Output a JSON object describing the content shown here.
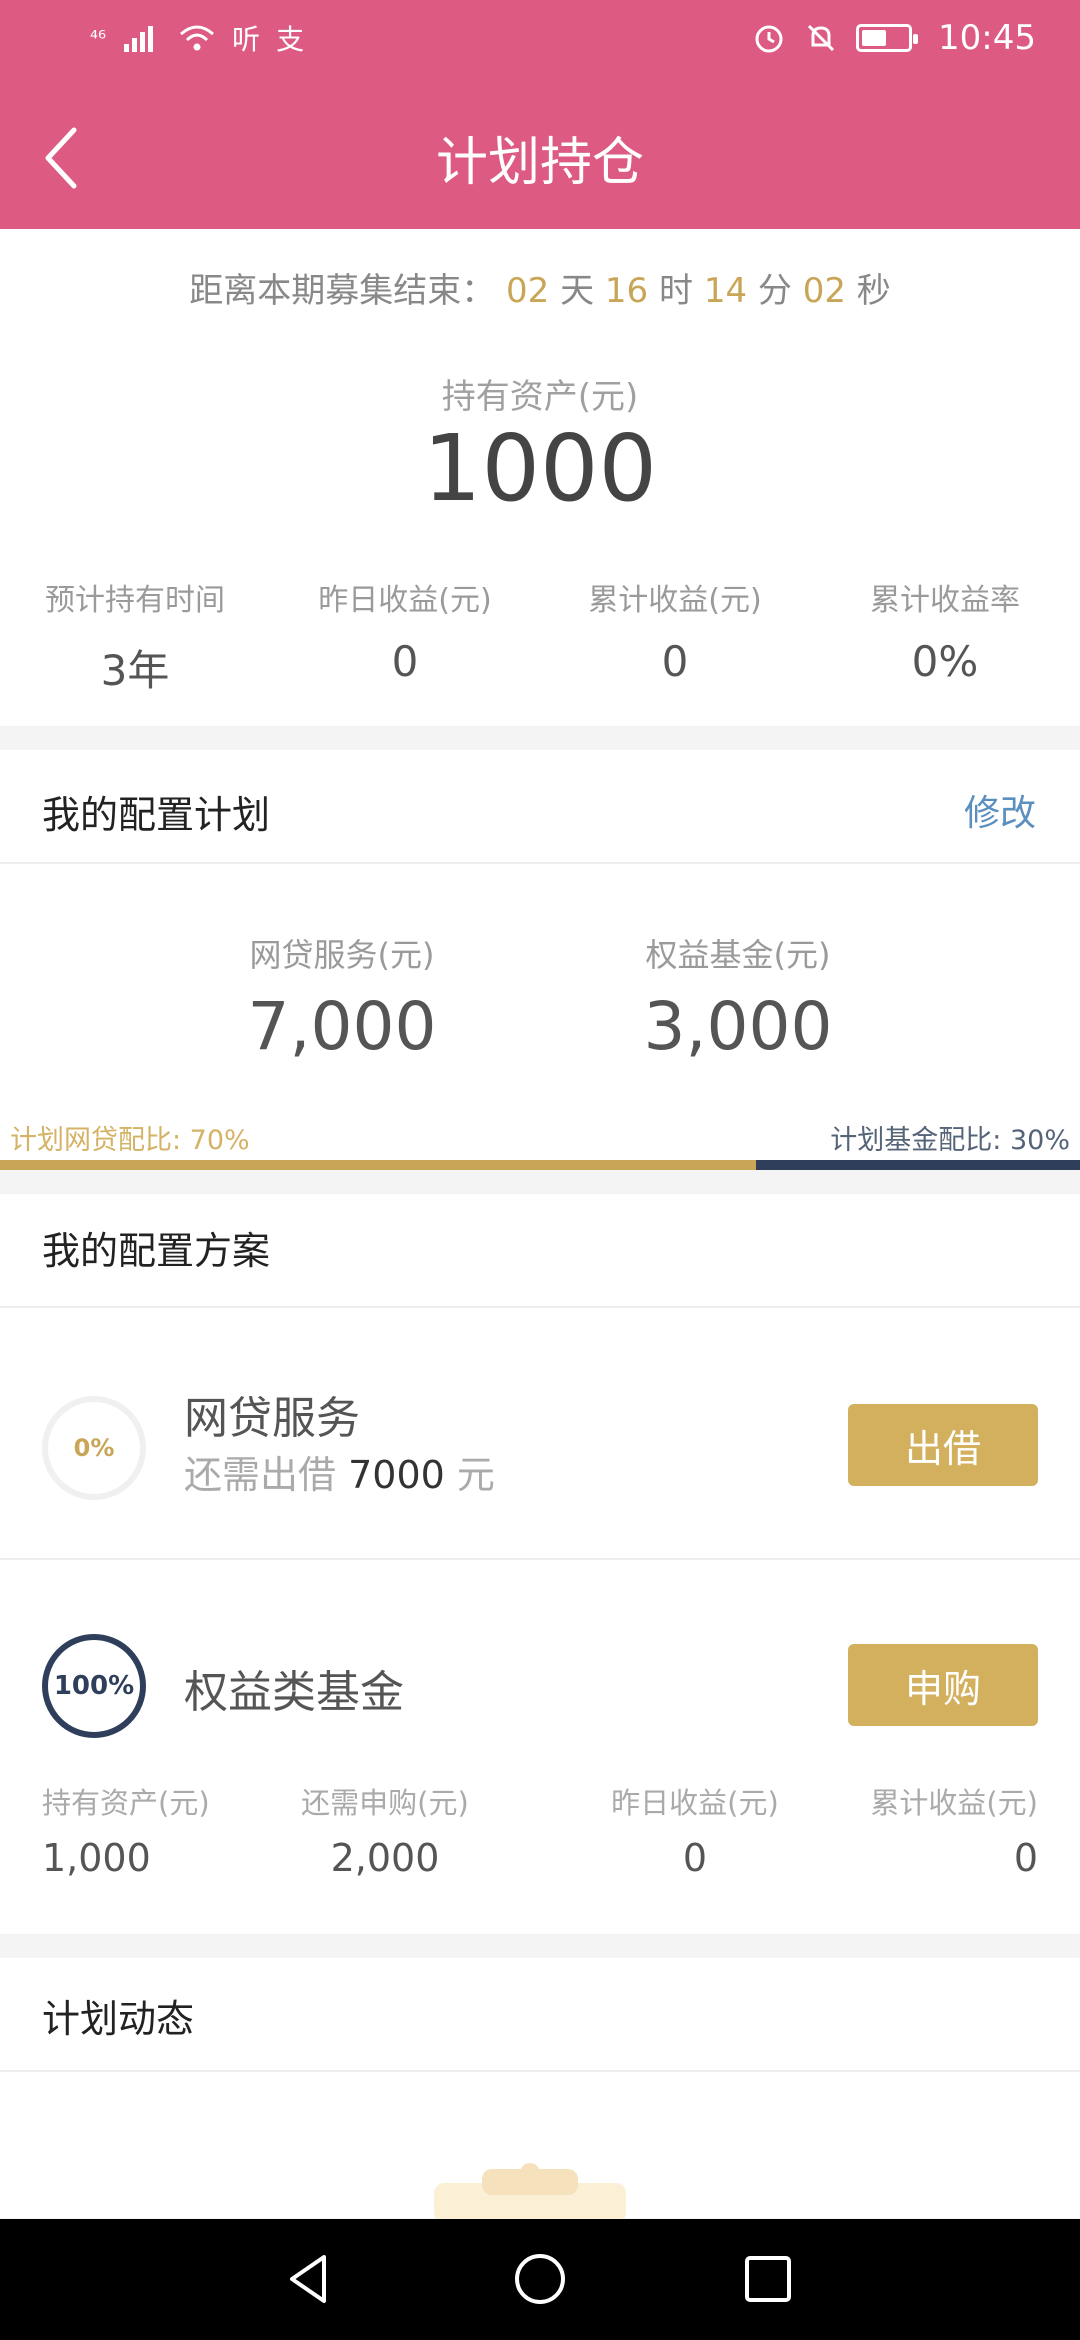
{
  "status_bar": {
    "network": "⁴⁶",
    "app_icons": [
      "听",
      "支"
    ],
    "time": "10:45",
    "icons": [
      "signal-icon",
      "wifi-icon",
      "alarm-icon",
      "mute-icon",
      "battery-icon"
    ]
  },
  "header": {
    "title": "计划持仓",
    "back_icon": "chevron-left-icon"
  },
  "countdown": {
    "prefix": "距离本期募集结束：",
    "days": "02",
    "days_unit": "天",
    "hours": "16",
    "hours_unit": "时",
    "minutes": "14",
    "minutes_unit": "分",
    "seconds": "02",
    "seconds_unit": "秒"
  },
  "holding": {
    "label": "持有资产(元)",
    "value": "1000"
  },
  "stats": [
    {
      "label": "预计持有时间",
      "value": "3年"
    },
    {
      "label": "昨日收益(元)",
      "value": "0"
    },
    {
      "label": "累计收益(元)",
      "value": "0"
    },
    {
      "label": "累计收益率",
      "value": "0%"
    }
  ],
  "plan": {
    "title": "我的配置计划",
    "edit_label": "修改",
    "p2p_label": "网贷服务(元)",
    "p2p_value": "7,000",
    "fund_label": "权益基金(元)",
    "fund_value": "3,000",
    "p2p_ratio_label": "计划网贷配比: 70%",
    "fund_ratio_label": "计划基金配比: 30%",
    "p2p_ratio": 0.7,
    "colors": {
      "p2p": "#c9a657",
      "fund": "#2f3e5a"
    }
  },
  "scheme": {
    "title": "我的配置方案",
    "p2p": {
      "progress_label": "0%",
      "name": "网贷服务",
      "sub_prefix": "还需出借",
      "sub_amount": "7000",
      "sub_unit": "元",
      "button_label": "出借"
    },
    "fund": {
      "progress_label": "100%",
      "name": "权益类基金",
      "button_label": "申购",
      "stats": [
        {
          "label": "持有资产(元)",
          "value": "1,000"
        },
        {
          "label": "还需申购(元)",
          "value": "2,000"
        },
        {
          "label": "昨日收益(元)",
          "value": "0"
        },
        {
          "label": "累计收益(元)",
          "value": "0"
        }
      ]
    }
  },
  "dynamics": {
    "title": "计划动态"
  },
  "nav": {
    "icons": [
      "back-triangle-icon",
      "home-circle-icon",
      "recents-square-icon"
    ]
  }
}
